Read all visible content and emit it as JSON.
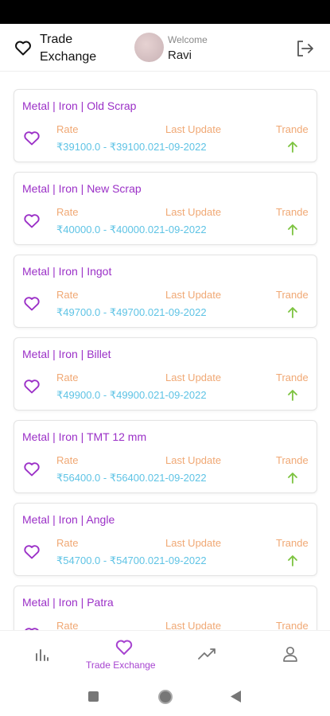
{
  "header": {
    "title": "Trade Exchange",
    "welcome_label": "Welcome",
    "username": "Ravi",
    "logout_icon": "logout-icon",
    "heart_icon": "heart-icon"
  },
  "colors": {
    "accent": "#9b30c7",
    "label": "#f0a874",
    "value": "#5ec3e5",
    "trend_up": "#7cc33f"
  },
  "labels": {
    "rate": "Rate",
    "last_update": "Last Update",
    "trend": "Trande"
  },
  "items": [
    {
      "title": "Metal | Iron | Old Scrap",
      "rate": "₹39100.0 - ₹39100.0",
      "date": "21-09-2022",
      "trend": "up"
    },
    {
      "title": "Metal | Iron | New Scrap",
      "rate": "₹40000.0 - ₹40000.0",
      "date": "21-09-2022",
      "trend": "up"
    },
    {
      "title": "Metal | Iron | Ingot",
      "rate": "₹49700.0 - ₹49700.0",
      "date": "21-09-2022",
      "trend": "up"
    },
    {
      "title": "Metal | Iron | Billet",
      "rate": "₹49900.0 - ₹49900.0",
      "date": "21-09-2022",
      "trend": "up"
    },
    {
      "title": "Metal | Iron | TMT 12 mm",
      "rate": "₹56400.0 - ₹56400.0",
      "date": "21-09-2022",
      "trend": "up"
    },
    {
      "title": "Metal | Iron | Angle",
      "rate": "₹54700.0 - ₹54700.0",
      "date": "21-09-2022",
      "trend": "up"
    },
    {
      "title": "Metal | Iron | Patra",
      "rate": "",
      "date": "",
      "trend": ""
    }
  ],
  "bottom_nav": [
    {
      "icon": "bar-chart-icon",
      "label": ""
    },
    {
      "icon": "heart-icon",
      "label": "Trade Exchange",
      "active": true
    },
    {
      "icon": "trend-line-icon",
      "label": ""
    },
    {
      "icon": "user-icon",
      "label": ""
    }
  ],
  "system_nav": [
    "recents-square-icon",
    "home-circle-icon",
    "back-triangle-icon"
  ]
}
